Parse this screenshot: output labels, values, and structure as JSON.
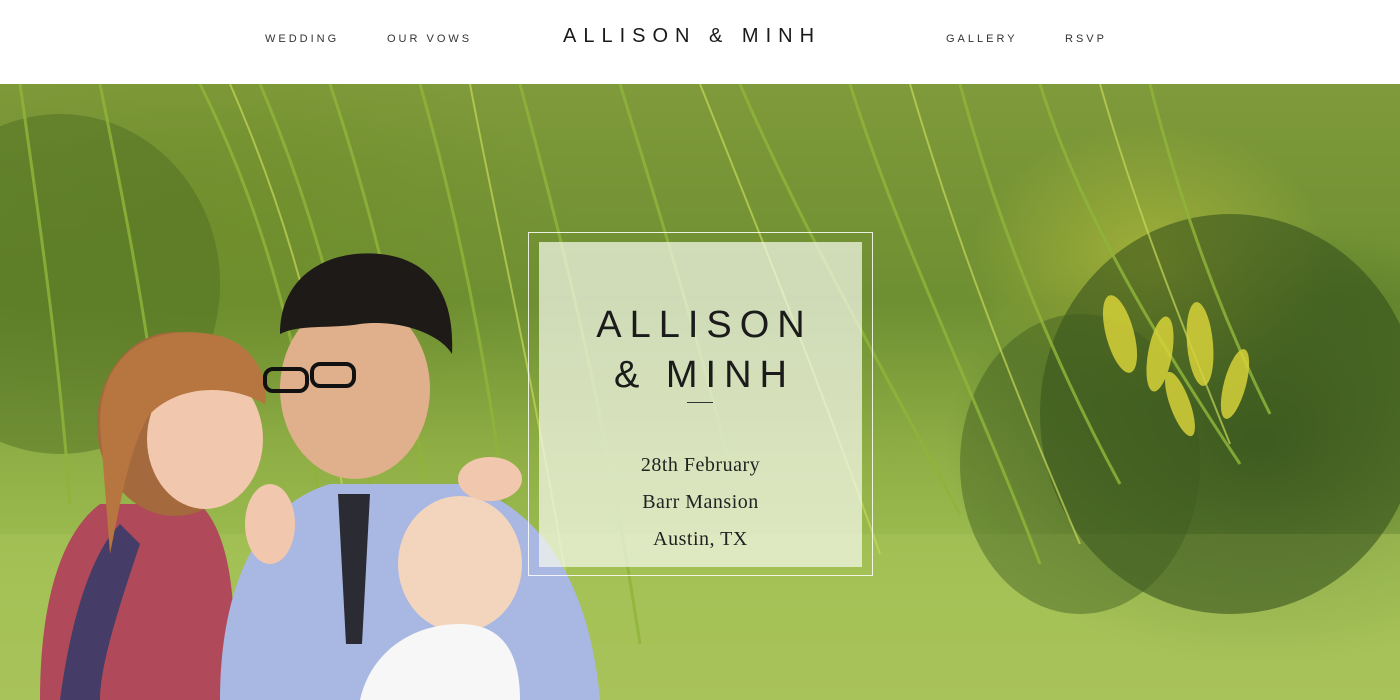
{
  "nav": {
    "left": [
      {
        "label": "WEDDING"
      },
      {
        "label": "OUR VOWS"
      }
    ],
    "right": [
      {
        "label": "GALLERY"
      },
      {
        "label": "RSVP"
      }
    ],
    "site_title": "ALLISON & MINH"
  },
  "hero": {
    "card": {
      "title_line1": "ALLISON",
      "title_line2": "& MINH",
      "date": "28th February",
      "venue": "Barr Mansion",
      "location": "Austin, TX"
    }
  },
  "colors": {
    "header_bg": "#ffffff",
    "text_dark": "#1b1b1b",
    "foliage": "#7f9a3a"
  }
}
